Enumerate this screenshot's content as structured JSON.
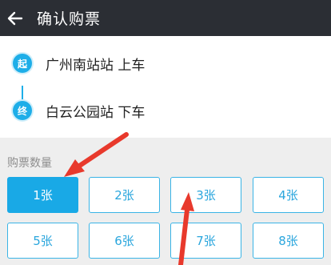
{
  "header": {
    "title": "确认购票"
  },
  "route": {
    "start": {
      "badge": "起",
      "name": "广州南站站 上车"
    },
    "end": {
      "badge": "终",
      "name": "白云公园站 下车"
    }
  },
  "quantity": {
    "label": "购票数量",
    "options": [
      "1张",
      "2张",
      "3张",
      "4张",
      "5张",
      "6张",
      "7张",
      "8张"
    ],
    "selected": "1张"
  },
  "colors": {
    "accent": "#19a9e6",
    "header_bg": "#2b2e34",
    "annotation_arrow": "#e8392c"
  }
}
